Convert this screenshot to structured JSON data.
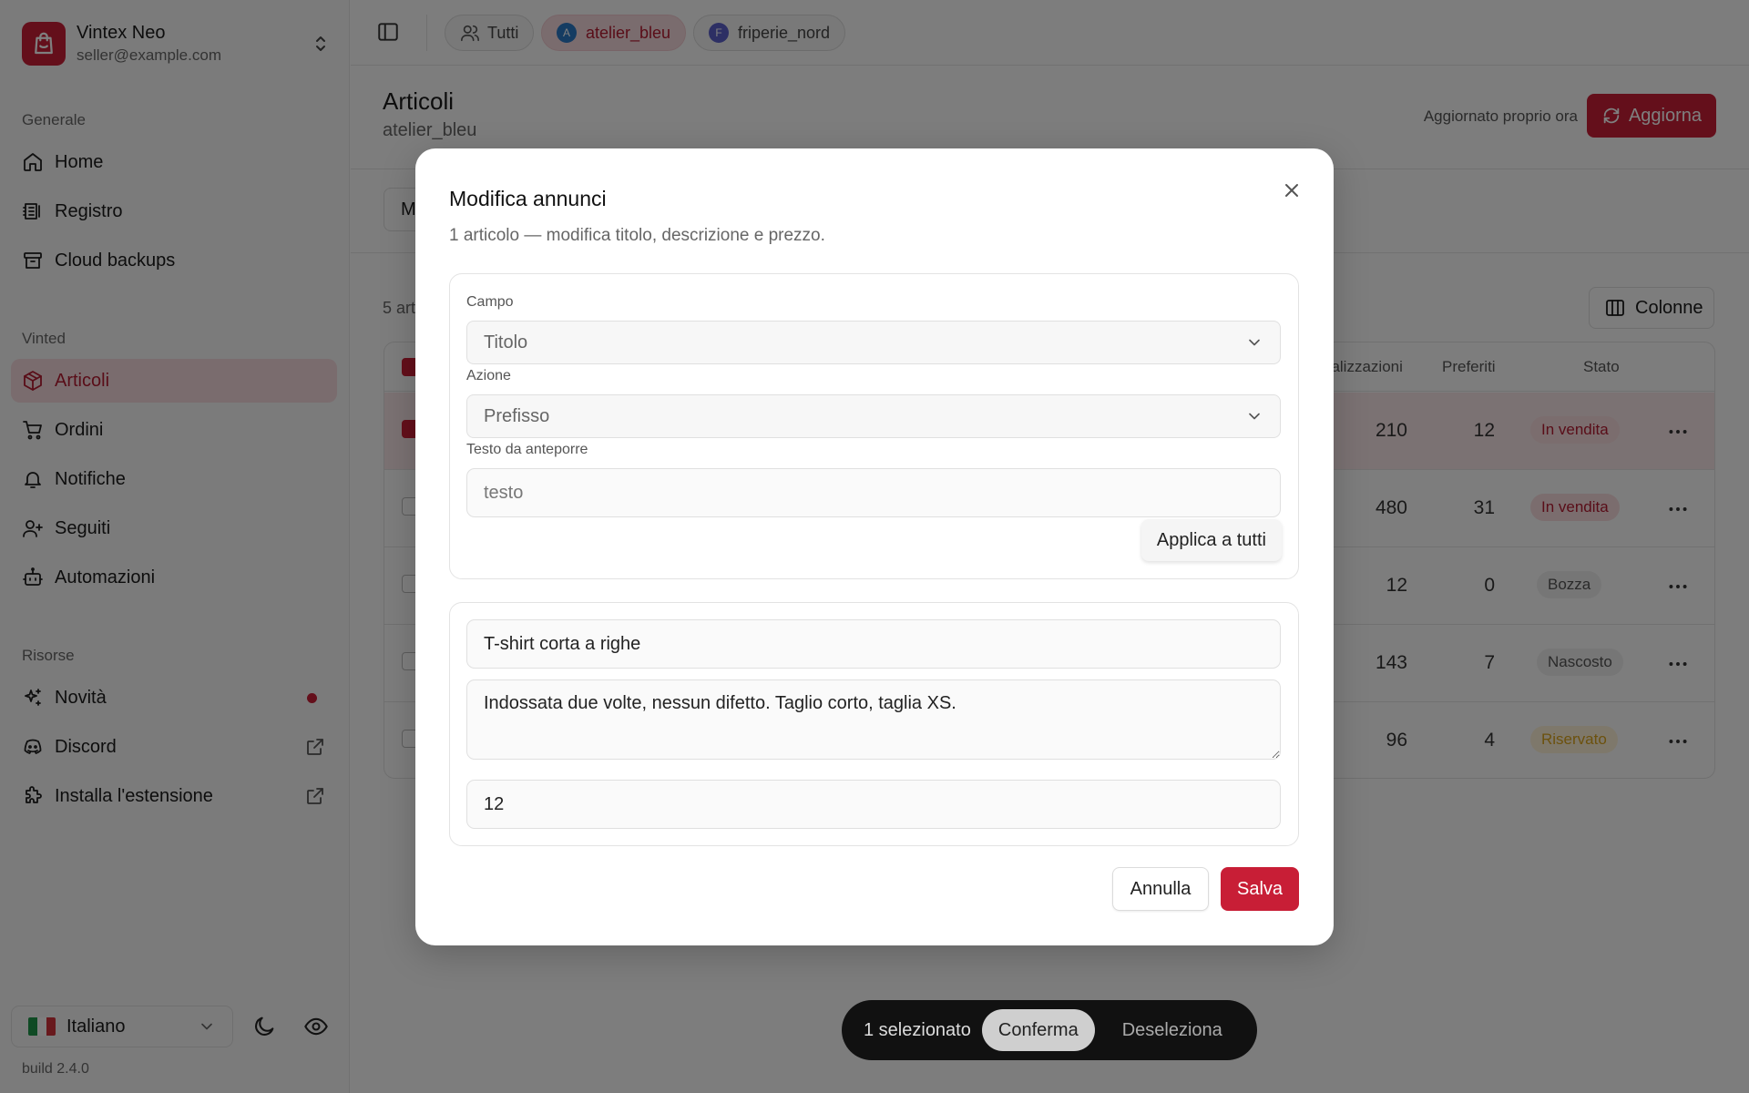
{
  "account": {
    "name": "Vintex Neo",
    "email": "seller@example.com"
  },
  "sidebar": {
    "groups": [
      {
        "label": "Generale"
      },
      {
        "label": "Vinted"
      },
      {
        "label": "Risorse"
      }
    ],
    "items": [
      {
        "label": "Home",
        "icon": "home-icon"
      },
      {
        "label": "Registro",
        "icon": "log-icon"
      },
      {
        "label": "Cloud backups",
        "icon": "archive-icon"
      },
      {
        "label": "Articoli",
        "icon": "package-icon",
        "active": true
      },
      {
        "label": "Ordini",
        "icon": "cart-icon"
      },
      {
        "label": "Notifiche",
        "icon": "bell-icon"
      },
      {
        "label": "Seguiti",
        "icon": "user-plus-icon"
      },
      {
        "label": "Automazioni",
        "icon": "bot-icon"
      },
      {
        "label": "Novità",
        "icon": "sparkles-icon"
      },
      {
        "label": "Discord",
        "icon": "discord-icon"
      },
      {
        "label": "Installa l'estensione",
        "icon": "puzzle-icon"
      }
    ],
    "language": "Italiano",
    "build": "build 2.4.0"
  },
  "topbar": {
    "chips": [
      {
        "label": "Tutti"
      },
      {
        "label": "atelier_bleu",
        "initial": "A"
      },
      {
        "label": "friperie_nord",
        "initial": "F"
      }
    ]
  },
  "page": {
    "title": "Articoli",
    "subtitle": "atelier_bleu",
    "updated": "Aggiornato proprio ora",
    "refresh_label": "Aggiorna",
    "filter_fragment": "M",
    "count_fragment": "5 art",
    "columns_label": "Colonne"
  },
  "table": {
    "headers": {
      "views": "ualizzazioni",
      "favs": "Preferiti",
      "status": "Stato"
    },
    "rows": [
      {
        "views": "210",
        "favs": "12",
        "status": "In vendita",
        "kind": "sale",
        "selected": true
      },
      {
        "views": "480",
        "favs": "31",
        "status": "In vendita",
        "kind": "sale"
      },
      {
        "views": "12",
        "favs": "0",
        "status": "Bozza",
        "kind": "neutral"
      },
      {
        "views": "143",
        "favs": "7",
        "status": "Nascosto",
        "kind": "neutral"
      },
      {
        "views": "96",
        "favs": "4",
        "status": "Riservato",
        "kind": "reserved"
      }
    ]
  },
  "modal": {
    "title": "Modifica annunci",
    "description": "1 articolo — modifica titolo, descrizione e prezzo.",
    "field_label": "Campo",
    "field_value": "Titolo",
    "action_label": "Azione",
    "action_value": "Prefisso",
    "text_label": "Testo da anteporre",
    "text_placeholder": "testo",
    "apply_label": "Applica a tutti",
    "item_title": "T-shirt corta a righe",
    "item_description": "Indossata due volte, nessun difetto. Taglio corto, taglia XS.",
    "item_price": "12",
    "cancel_label": "Annulla",
    "save_label": "Salva"
  },
  "bulkbar": {
    "count": "1 selezionato",
    "confirm": "Conferma",
    "deselect": "Deseleziona"
  },
  "colors": {
    "brand": "#c81e36",
    "active_bg": "#f5d9dd",
    "sale_badge_bg": "#f6dadd",
    "reserved_text": "#d9a21b"
  }
}
